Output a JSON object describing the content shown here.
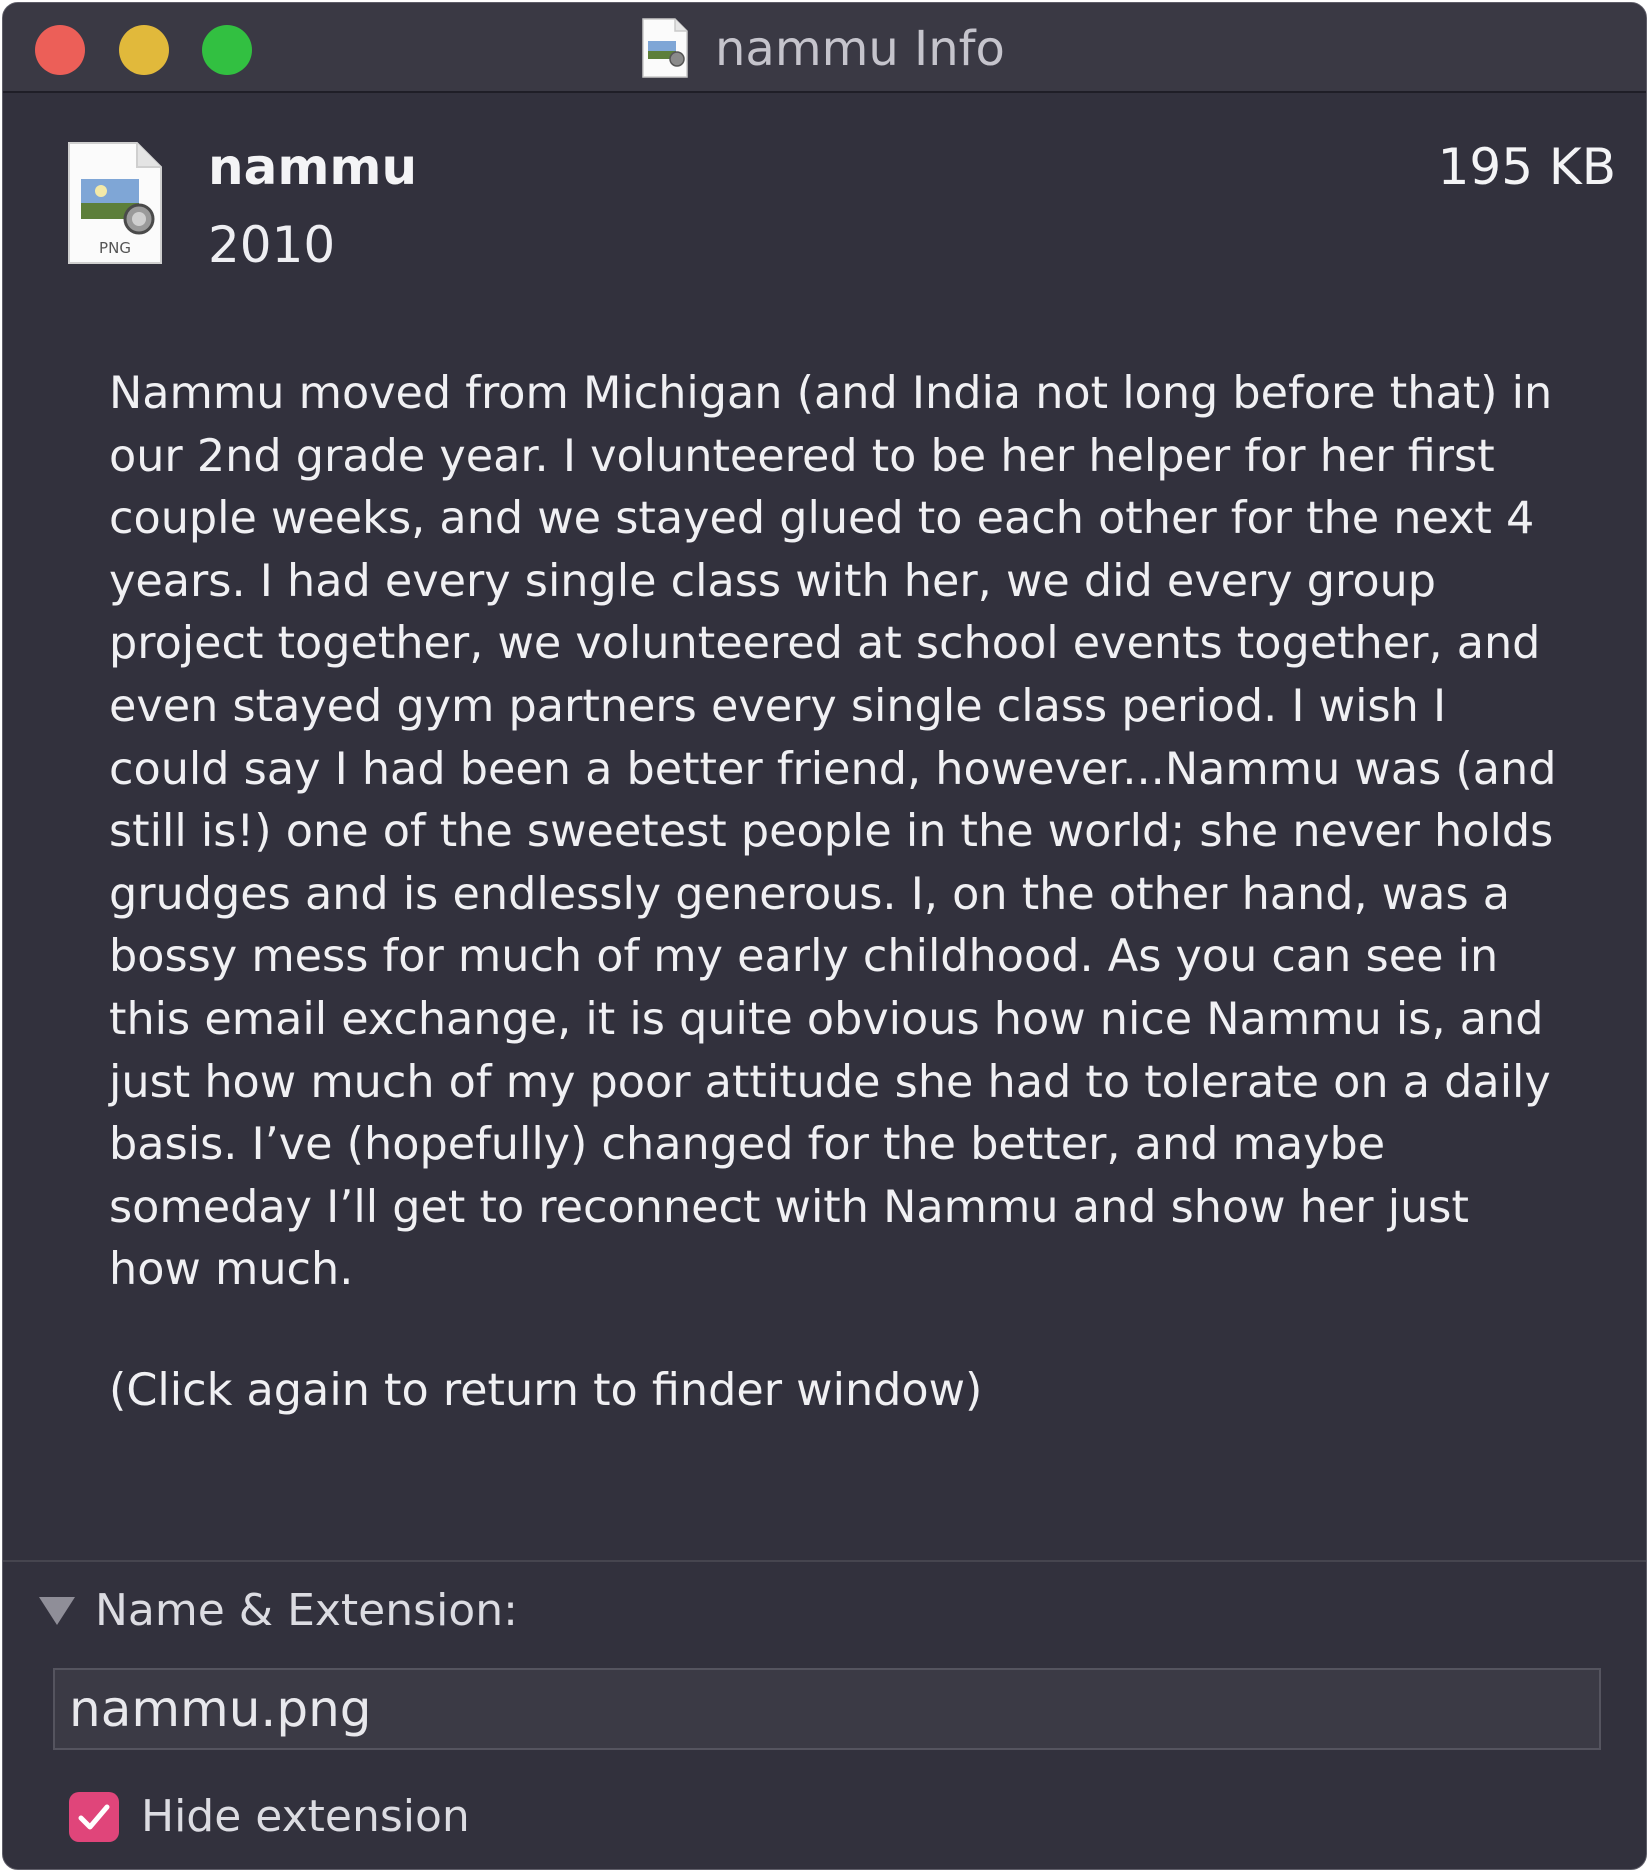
{
  "window": {
    "title": "nammu Info"
  },
  "file": {
    "name": "nammu",
    "date": "2010",
    "size": "195 KB",
    "icon_badge": "PNG"
  },
  "comment": {
    "body": "Nammu moved from Michigan (and India not long before that) in our 2nd grade year. I volunteered to be her helper for her first couple weeks, and we stayed glued to each other for the next 4 years. I had every single class with her, we did every group project together, we volunteered at school events together, and even stayed gym partners every single class period. I wish I could say I had been a better friend, however...Nammu was (and still is!) one of the sweetest people in the world; she never holds grudges and is endlessly generous. I, on the other hand, was a bossy mess for much of my early childhood. As you can see in this email exchange, it is quite obvious how nice Nammu is, and just how much of my poor attitude she had to tolerate on a daily basis. I’ve (hopefully) changed for the better, and maybe someday I’ll get to reconnect with Nammu and show her just how much.",
    "hint": "(Click again to return to finder window)"
  },
  "name_extension": {
    "section_label": "Name & Extension:",
    "filename_value": "nammu.png",
    "hide_extension_label": "Hide extension",
    "hide_extension_checked": true
  },
  "colors": {
    "window_bg": "#32313d",
    "close": "#ec5f58",
    "minimize": "#e1b93b",
    "maximize": "#32c041",
    "checkbox_accent": "#e0457a"
  },
  "icons": {
    "title": "png-file-icon",
    "file": "png-file-icon",
    "disclosure": "disclosure-triangle-down-icon",
    "check": "checkmark-icon"
  }
}
